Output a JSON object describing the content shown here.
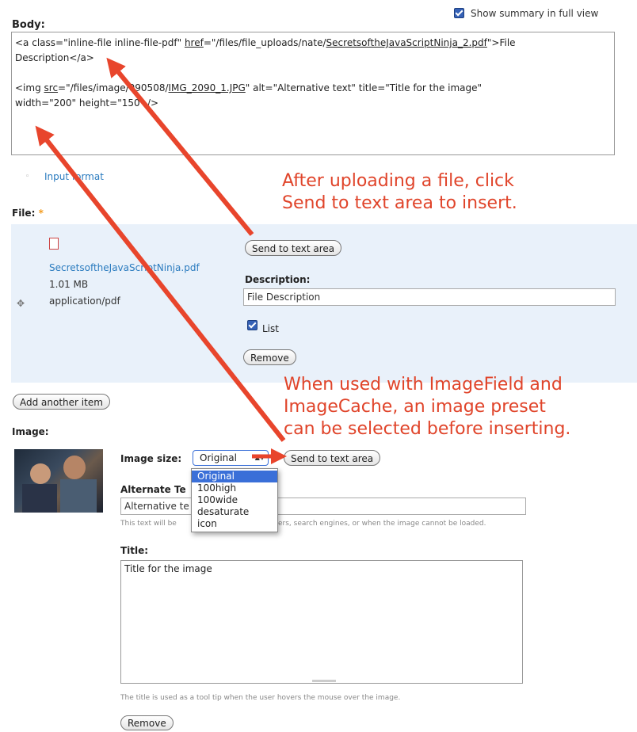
{
  "header": {
    "body_label": "Body:",
    "show_summary_label": "Show summary in full view"
  },
  "body_textarea": {
    "line1_prefix": "<a class=\"inline-file inline-file-pdf\" ",
    "line1_href": "href",
    "line1_eq": "=\"/files/file_uploads/nate/",
    "line1_filename": "SecretsoftheJavaScriptNinja_2.pdf",
    "line1_suffix": "\">File",
    "line2": "Description</a>",
    "line3_img": "<img ",
    "line3_src": "src",
    "line3_mid": "=\"/files/image/090508/",
    "line3_file": "IMG_2090_1.JPG",
    "line3_rest": "\" alt=\"Alternative text\" title=\"Title for the image\"",
    "line4": "width=\"200\" height=\"150\" />"
  },
  "input_format_link": "Input format",
  "file_field": {
    "label": "File:",
    "required_mark": "*",
    "filename": "SecretsoftheJavaScriptNinja.pdf",
    "size": "1.01 MB",
    "mime": "application/pdf",
    "send_button": "Send to text area",
    "description_label": "Description:",
    "description_value": "File Description",
    "list_label": "List",
    "remove_button": "Remove"
  },
  "add_another_button": "Add another item",
  "image_field": {
    "label": "Image:",
    "size_label": "Image size:",
    "size_selected": "Original",
    "size_options": [
      "Original",
      "100high",
      "100wide",
      "desaturate",
      "icon"
    ],
    "send_button": "Send to text area",
    "alt_label": "Alternate Te",
    "alt_value": "Alternative te",
    "alt_hint_left": "This text will be",
    "alt_hint_right": "ers, search engines, or when the image cannot be loaded.",
    "title_label": "Title:",
    "title_value": "Title for the image",
    "title_hint": "The title is used as a tool tip when the user hovers the mouse over the image.",
    "remove_button": "Remove"
  },
  "annotations": {
    "annotation1": [
      "After uploading a file, click",
      "Send to text area to insert."
    ],
    "annotation2": [
      "When used with ImageField and",
      "ImageCache, an image preset",
      "can be selected before inserting."
    ]
  },
  "colors": {
    "annotation": "#e0442a",
    "arrow": "#e8452c",
    "link": "#2a7bbf",
    "panel": "#e9f1fa"
  }
}
